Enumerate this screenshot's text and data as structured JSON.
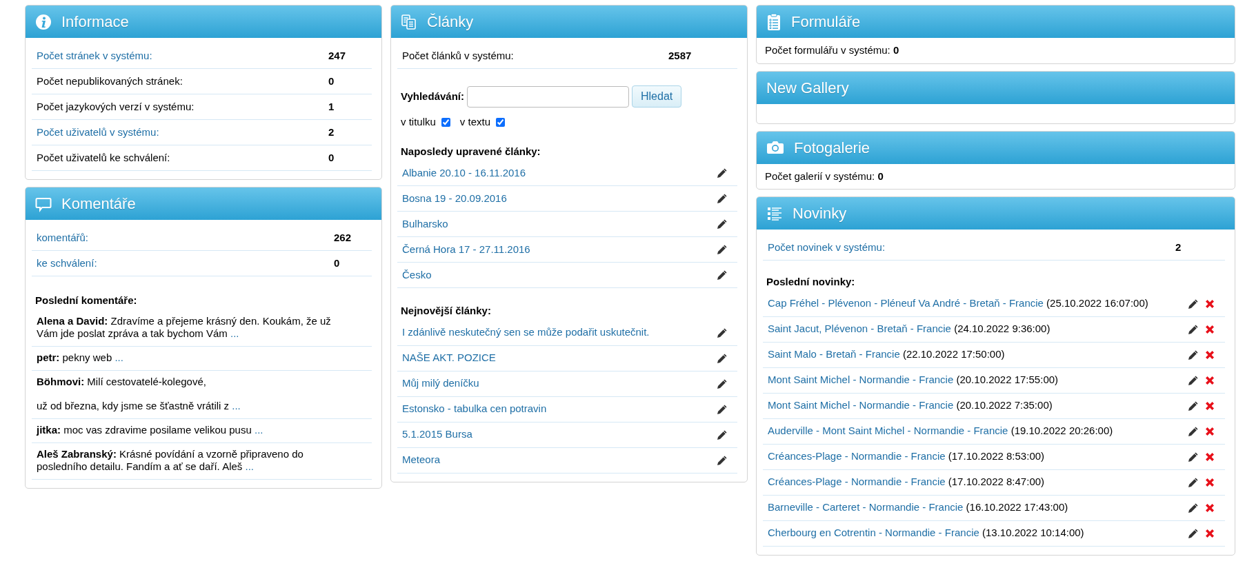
{
  "info_panel": {
    "title": "Informace",
    "rows": [
      {
        "label": "Počet stránek v systému:",
        "value": "247",
        "linked": true
      },
      {
        "label": "Počet nepublikovaných stránek:",
        "value": "0",
        "linked": false
      },
      {
        "label": "Počet jazykových verzí v systému:",
        "value": "1",
        "linked": false
      },
      {
        "label": "Počet uživatelů v systému:",
        "value": "2",
        "linked": true
      },
      {
        "label": "Počet uživatelů ke schválení:",
        "value": "0",
        "linked": false
      }
    ]
  },
  "comments_panel": {
    "title": "Komentáře",
    "rows": [
      {
        "label": "komentářů:",
        "value": "262",
        "linked": true
      },
      {
        "label": "ke schválení:",
        "value": "0",
        "linked": true
      }
    ],
    "recent_heading": "Poslední komentáře:",
    "comments": [
      {
        "author": "Alena a David:",
        "paragraphs": [
          "Zdravíme a přejeme krásný den. Koukám, že už Vám jde poslat zpráva a tak bychom Vám"
        ],
        "more": "..."
      },
      {
        "author": "petr:",
        "paragraphs": [
          "pekny web"
        ],
        "more": "..."
      },
      {
        "author": "Böhmovi:",
        "paragraphs": [
          "Milí cestovatelé-kolegové,",
          "už od března, kdy jsme se šťastně vrátili z"
        ],
        "more": "..."
      },
      {
        "author": "jitka:",
        "paragraphs": [
          "moc vas zdravime posilame velikou pusu"
        ],
        "more": "..."
      },
      {
        "author": "Aleš Zabranský:",
        "paragraphs": [
          "Krásné povídání a vzorně připraveno do posledního detailu. Fandím a ať se daří. Aleš"
        ],
        "more": "..."
      }
    ]
  },
  "articles_panel": {
    "title": "Články",
    "rows": [
      {
        "label": "Počet článků v systému:",
        "value": "2587",
        "linked": false
      }
    ],
    "search": {
      "label": "Vyhledávání:",
      "button": "Hledat"
    },
    "filters": [
      {
        "label": "v titulku",
        "checked": true
      },
      {
        "label": "v textu",
        "checked": true
      }
    ],
    "recent_heading": "Naposledy upravené články:",
    "recent": [
      "Albanie 20.10 - 16.11.2016",
      "Bosna 19 - 20.09.2016",
      "Bulharsko",
      "Černá Hora 17 - 27.11.2016",
      "Česko"
    ],
    "newest_heading": "Nejnovější články:",
    "newest": [
      "I zdánlivě neskutečný sen se může podařit uskutečnit.",
      "NAŠE AKT. POZICE",
      "Můj milý deníčku",
      "Estonsko - tabulka cen potravin",
      "5.1.2015 Bursa",
      "Meteora"
    ]
  },
  "forms_panel": {
    "title": "Formuláře",
    "text": "Počet formulářu v systému: **0**"
  },
  "gallery_panel": {
    "title": "New Gallery"
  },
  "photo_panel": {
    "title": "Fotogalerie",
    "text": "Počet galerií v systému: **0**"
  },
  "news_panel": {
    "title": "Novinky",
    "rows": [
      {
        "label": "Počet novinek v systému:",
        "value": "2",
        "linked": true
      }
    ],
    "recent_heading": "Poslední novinky:",
    "news": [
      {
        "title": "Cap Fréhel - Plévenon - Pléneuf Va André - Bretaň - Francie",
        "date": "(25.10.2022 16:07:00)"
      },
      {
        "title": "Saint Jacut, Plévenon - Bretaň - Francie",
        "date": "(24.10.2022 9:36:00)"
      },
      {
        "title": "Saint Malo - Bretaň - Francie",
        "date": "(22.10.2022 17:50:00)"
      },
      {
        "title": "Mont Saint Michel - Normandie - Francie",
        "date": "(20.10.2022 17:55:00)"
      },
      {
        "title": "Mont Saint Michel - Normandie - Francie",
        "date": "(20.10.2022 7:35:00)"
      },
      {
        "title": "Auderville - Mont Saint Michel - Normandie - Francie",
        "date": "(19.10.2022 20:26:00)"
      },
      {
        "title": "Créances-Plage - Normandie - Francie",
        "date": "(17.10.2022 8:53:00)"
      },
      {
        "title": "Créances-Plage - Normandie - Francie",
        "date": "(17.10.2022 8:47:00)"
      },
      {
        "title": "Barneville - Carteret - Normandie - Francie",
        "date": "(16.10.2022 17:43:00)"
      },
      {
        "title": "Cherbourg en Cotrentin - Normandie - Francie",
        "date": "(13.10.2022 10:14:00)"
      }
    ]
  }
}
